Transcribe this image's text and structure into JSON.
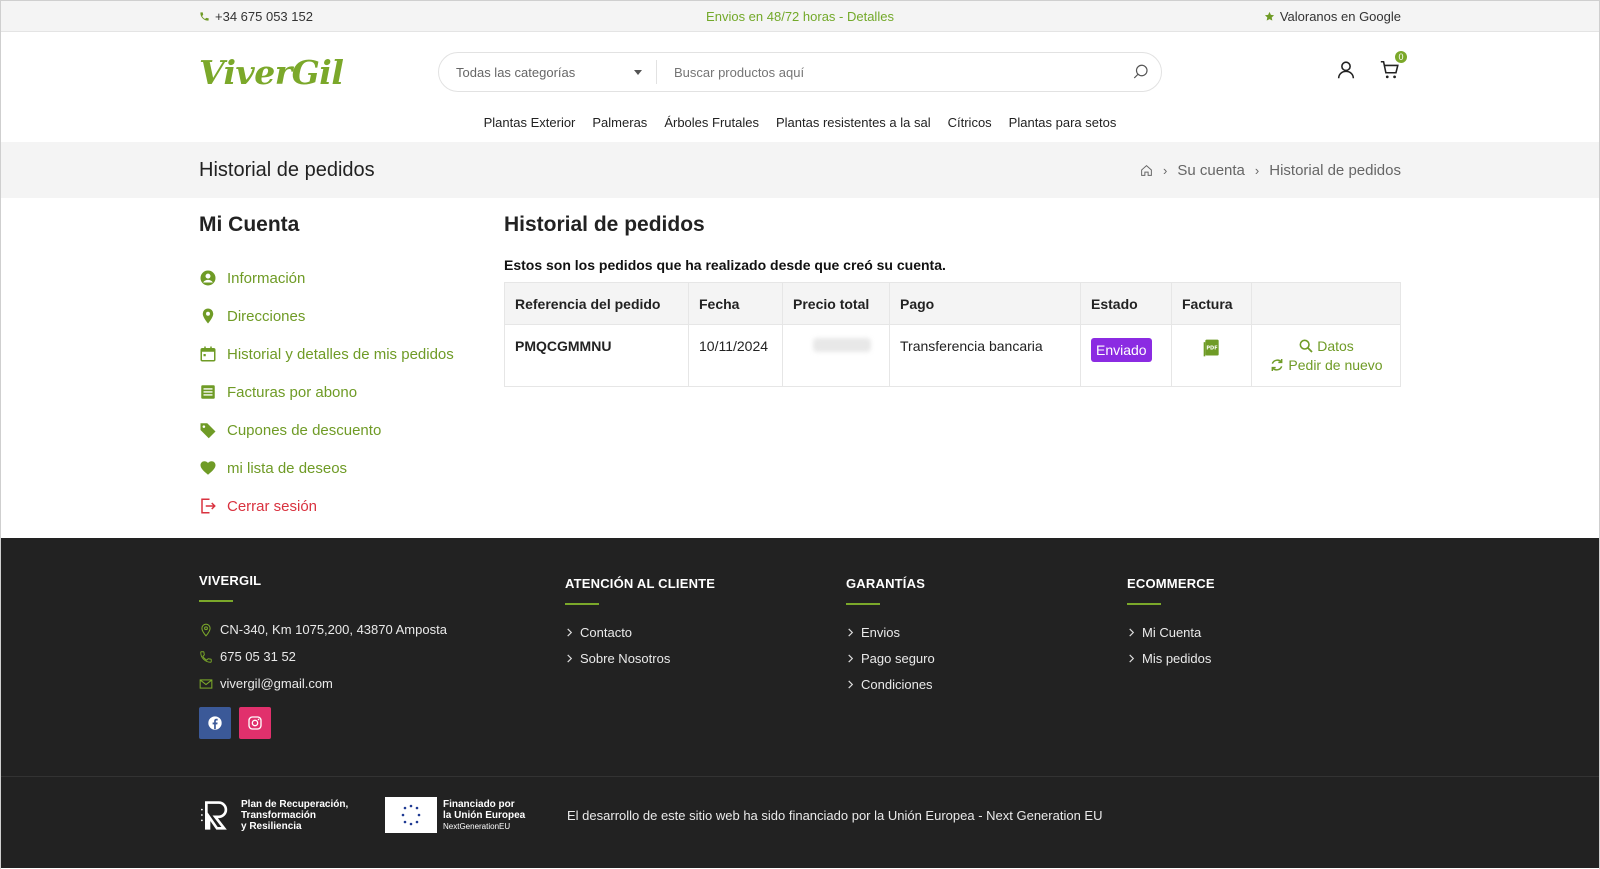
{
  "topbar": {
    "phone": "+34 675 053 152",
    "promo": "Envios en 48/72 horas - Detalles",
    "google": "Valoranos en Google"
  },
  "header": {
    "logo": "ViverGil",
    "category_select": "Todas las categorías",
    "search_placeholder": "Buscar productos aquí",
    "cart_count": "0"
  },
  "nav": {
    "items": [
      "Plantas Exterior",
      "Palmeras",
      "Árboles Frutales",
      "Plantas resistentes a la sal",
      "Cítricos",
      "Plantas para setos"
    ]
  },
  "titleband": {
    "title": "Historial de pedidos",
    "breadcrumb": [
      "Su cuenta",
      "Historial de pedidos"
    ]
  },
  "sidebar": {
    "title": "Mi Cuenta",
    "items": [
      {
        "label": "Información",
        "icon": "user-circle-icon"
      },
      {
        "label": "Direcciones",
        "icon": "map-pin-icon"
      },
      {
        "label": "Historial y detalles de mis pedidos",
        "icon": "calendar-icon"
      },
      {
        "label": "Facturas por abono",
        "icon": "list-icon"
      },
      {
        "label": "Cupones de descuento",
        "icon": "tag-icon"
      },
      {
        "label": "mi lista de deseos",
        "icon": "heart-icon"
      },
      {
        "label": "Cerrar sesión",
        "icon": "logout-icon"
      }
    ]
  },
  "orders": {
    "title": "Historial de pedidos",
    "intro": "Estos son los pedidos que ha realizado desde que creó su cuenta.",
    "columns": [
      "Referencia del pedido",
      "Fecha",
      "Precio total",
      "Pago",
      "Estado",
      "Factura",
      ""
    ],
    "rows": [
      {
        "reference": "PMQCGMMNU",
        "date": "10/11/2024",
        "payment": "Transferencia bancaria",
        "status": "Enviado",
        "details_label": "Datos",
        "reorder_label": "Pedir de nuevo"
      }
    ]
  },
  "footer": {
    "col1": {
      "title": "VIVERGIL",
      "address": "CN-340, Km 1075,200, 43870 Amposta",
      "phone": "675 05 31 52",
      "email": "vivergil@gmail.com"
    },
    "col2": {
      "title": "ATENCIÓN AL CLIENTE",
      "items": [
        "Contacto",
        "Sobre Nosotros"
      ]
    },
    "col3": {
      "title": "GARANTÍAS",
      "items": [
        "Envios",
        "Pago seguro",
        "Condiciones"
      ]
    },
    "col4": {
      "title": "ECOMMERCE",
      "items": [
        "Mi Cuenta",
        "Mis pedidos"
      ]
    },
    "prtr_lines": [
      "Plan de Recuperación,",
      "Transformación",
      "y Resiliencia"
    ],
    "eu_lines": [
      "Financiado por",
      "la Unión Europea",
      "NextGenerationEU"
    ],
    "note": "El desarrollo de este sitio web ha sido financiado por la Unión Europea - Next Generation EU"
  },
  "colors": {
    "accent": "#7ba82a",
    "status": "#8b2be2",
    "logout": "#d9323f",
    "footer_bg": "#222222"
  }
}
